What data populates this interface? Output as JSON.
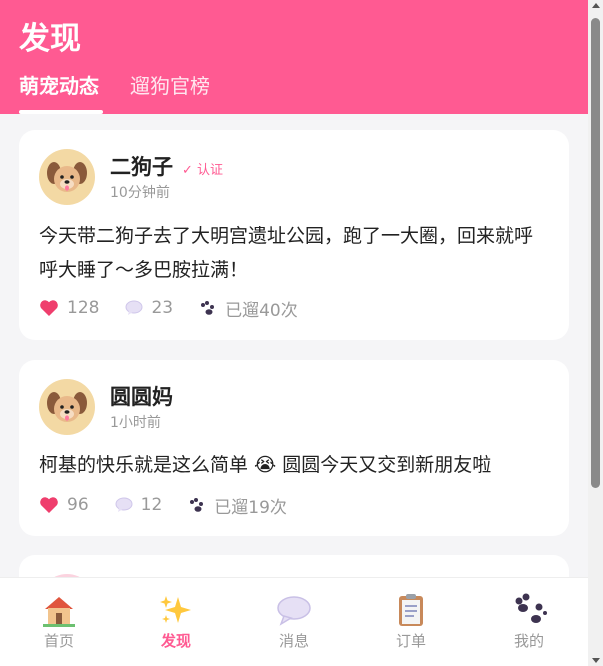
{
  "header": {
    "title": "发现",
    "tabs": [
      {
        "label": "萌宠动态",
        "active": true
      },
      {
        "label": "遛狗官榜",
        "active": false
      }
    ]
  },
  "posts": [
    {
      "author": "二狗子",
      "verified_label": "✓ 认证",
      "time": "10分钟前",
      "content": "今天带二狗子去了大明宫遗址公园，跑了一大圈，回来就呼呼大睡了～多巴胺拉满！",
      "likes": "128",
      "comments": "23",
      "walks": "已遛40次"
    },
    {
      "author": "圆圆妈",
      "time": "1小时前",
      "content": "柯基的快乐就是这么简单 😭 圆圆今天又交到新朋友啦",
      "likes": "96",
      "comments": "12",
      "walks": "已遛19次"
    }
  ],
  "tabbar": {
    "items": [
      {
        "label": "首页",
        "icon": "house-icon",
        "active": false
      },
      {
        "label": "发现",
        "icon": "sparkles-icon",
        "active": true
      },
      {
        "label": "消息",
        "icon": "speech-bubble-icon",
        "active": false
      },
      {
        "label": "订单",
        "icon": "clipboard-icon",
        "active": false
      },
      {
        "label": "我的",
        "icon": "paw-icon",
        "active": false
      }
    ]
  },
  "colors": {
    "accent": "#ff5a92",
    "background": "#f5f5f7",
    "text_muted": "#999999"
  }
}
